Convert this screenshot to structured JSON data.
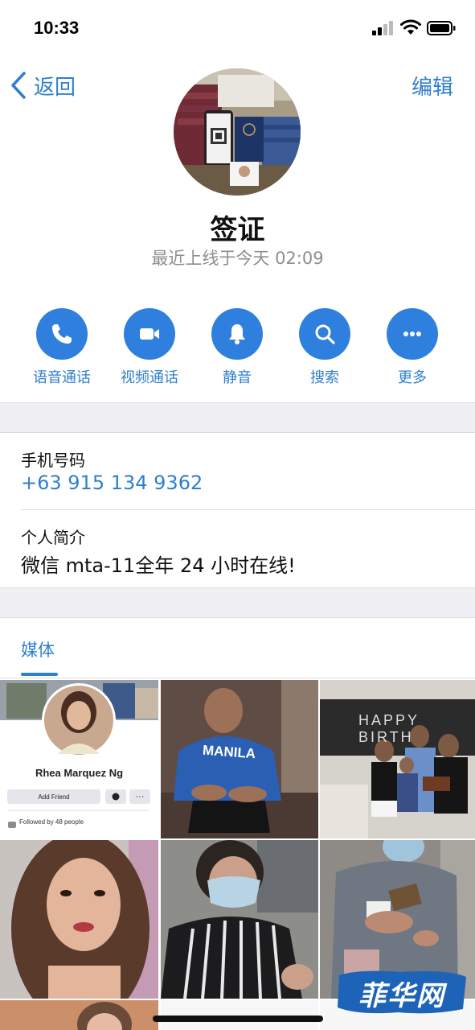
{
  "status_bar": {
    "time": "10:33"
  },
  "nav": {
    "back_label": "返回",
    "edit_label": "编辑"
  },
  "profile": {
    "name": "签证",
    "last_seen": "最近上线于今天 02:09"
  },
  "actions": [
    {
      "label": "语音通话",
      "icon": "phone-icon"
    },
    {
      "label": "视频通话",
      "icon": "video-camera-icon"
    },
    {
      "label": "静音",
      "icon": "bell-icon"
    },
    {
      "label": "搜索",
      "icon": "search-icon"
    },
    {
      "label": "更多",
      "icon": "more-dots-icon"
    }
  ],
  "info": {
    "phone_label": "手机号码",
    "phone_value": "+63 915 134 9362",
    "bio_label": "个人简介",
    "bio_value": "微信 mta-11全年 24 小时在线!"
  },
  "media": {
    "tab_label": "媒体",
    "fb_card": {
      "name": "Rhea Marquez Ng",
      "add_friend": "Add Friend",
      "followed": "Followed by 48 people"
    },
    "shirt_text": "MANILA",
    "banner_text": "HAPPY BIRTH"
  },
  "watermark": {
    "text": "菲华网"
  },
  "colors": {
    "accent": "#2f80de",
    "link": "#2f7fcf",
    "secondary_text": "#8e8e93",
    "separator_band": "#efeff4"
  }
}
